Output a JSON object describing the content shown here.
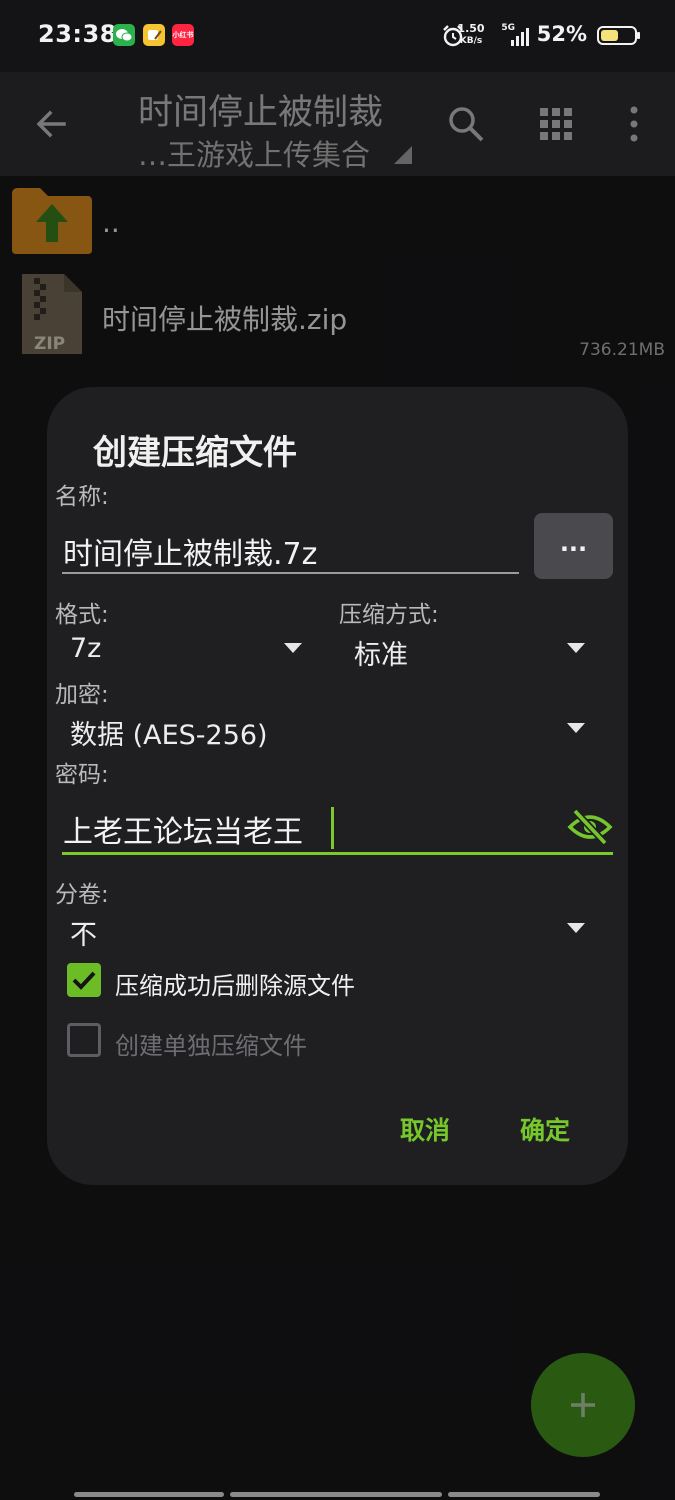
{
  "status_bar": {
    "time": "23:38",
    "notification_icons": [
      "wechat-icon",
      "notes-app-icon",
      "xiaohongshu-icon"
    ],
    "xiaohongshu_text": "小红书",
    "net_speed_value": "1.50",
    "net_speed_unit": "KB/s",
    "network_type": "5G",
    "battery_percent": "52%",
    "battery_level": 0.52
  },
  "app_bar": {
    "title": "时间停止被制裁",
    "subtitle": "…王游戏上传集合",
    "icons": [
      "back-arrow-icon",
      "search-icon",
      "grid-view-icon",
      "more-vert-icon"
    ]
  },
  "file_list": {
    "items": [
      {
        "name": "..",
        "icon": "folder-up-icon"
      },
      {
        "name": "时间停止被制裁.zip",
        "icon": "zip-file-icon",
        "icon_text": "ZIP",
        "size": "736.21MB"
      }
    ]
  },
  "dialog": {
    "title": "创建压缩文件",
    "name_label": "名称:",
    "name_value": "时间停止被制裁.7z",
    "browse_label": "...",
    "format_label": "格式:",
    "format_value": "7z",
    "compression_label": "压缩方式:",
    "compression_value": "标准",
    "encryption_label": "加密:",
    "encryption_value": "数据 (AES-256)",
    "password_label": "密码:",
    "password_value": "上老王论坛当老王",
    "split_label": "分卷:",
    "split_value": "不",
    "delete_after_label": "压缩成功后删除源文件",
    "delete_after_checked": true,
    "separate_archive_label": "创建单独压缩文件",
    "separate_archive_checked": false,
    "cancel_label": "取消",
    "ok_label": "确定",
    "accent_color": "#76c72c"
  },
  "fab": {
    "icon": "plus-icon"
  }
}
